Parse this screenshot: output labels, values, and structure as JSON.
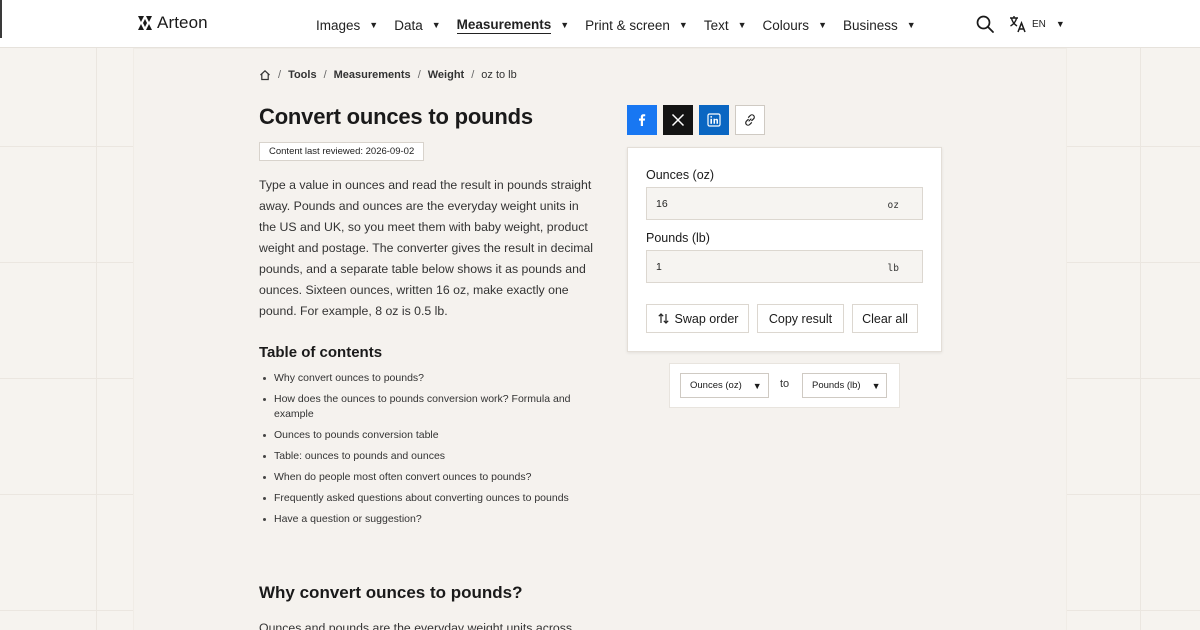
{
  "header": {
    "logo_text": "Arteon",
    "nav": [
      {
        "label": "Images"
      },
      {
        "label": "Data"
      },
      {
        "label": "Measurements"
      },
      {
        "label": "Print & screen"
      },
      {
        "label": "Text"
      },
      {
        "label": "Colours"
      },
      {
        "label": "Business"
      }
    ],
    "active_nav": "Measurements",
    "lang_code": "EN",
    "search_icon": "search-icon",
    "lang_icon": "translate-icon"
  },
  "breadcrumb": {
    "items": [
      "Tools",
      "Measurements",
      "Weight"
    ],
    "current": "oz to lb",
    "separator": "/"
  },
  "page": {
    "title": "Convert ounces to pounds",
    "reviewed": "Content last reviewed: 2026-09-02",
    "intro": "Type a value in ounces and read the result in pounds straight away. Pounds and ounces are the everyday weight units in the US and UK, so you meet them with baby weight, product weight and postage. The converter gives the result in decimal pounds, and a separate table below shows it as pounds and ounces. Sixteen ounces, written 16 oz, make exactly one pound. For example, 8 oz is 0.5 lb.",
    "toc_title": "Table of contents",
    "toc": [
      "Why convert ounces to pounds?",
      "How does the ounces to pounds conversion work? Formula and example",
      "Ounces to pounds conversion table",
      "Table: ounces to pounds and ounces",
      "When do people most often convert ounces to pounds?",
      "Frequently asked questions about converting ounces to pounds",
      "Have a question or suggestion?"
    ],
    "section_heading": "Why convert ounces to pounds?",
    "section_text_start": "Ounces and pounds are the everyday weight units across"
  },
  "share": {
    "facebook_icon": "facebook-icon",
    "x_icon": "x-icon",
    "linkedin_icon": "linkedin-icon",
    "link_icon": "link-icon",
    "colors": {
      "facebook": "#1877f2",
      "x": "#141414",
      "linkedin": "#0a66c2"
    }
  },
  "converter": {
    "from_label": "Ounces (oz)",
    "from_value": "16",
    "from_unit": "oz",
    "to_label": "Pounds (lb)",
    "to_value": "1",
    "to_unit": "lb",
    "swap_label": "Swap order",
    "copy_label": "Copy result",
    "clear_label": "Clear all"
  },
  "unit_select": {
    "from": "Ounces (oz)",
    "to_word": "to",
    "to": "Pounds (lb)"
  }
}
